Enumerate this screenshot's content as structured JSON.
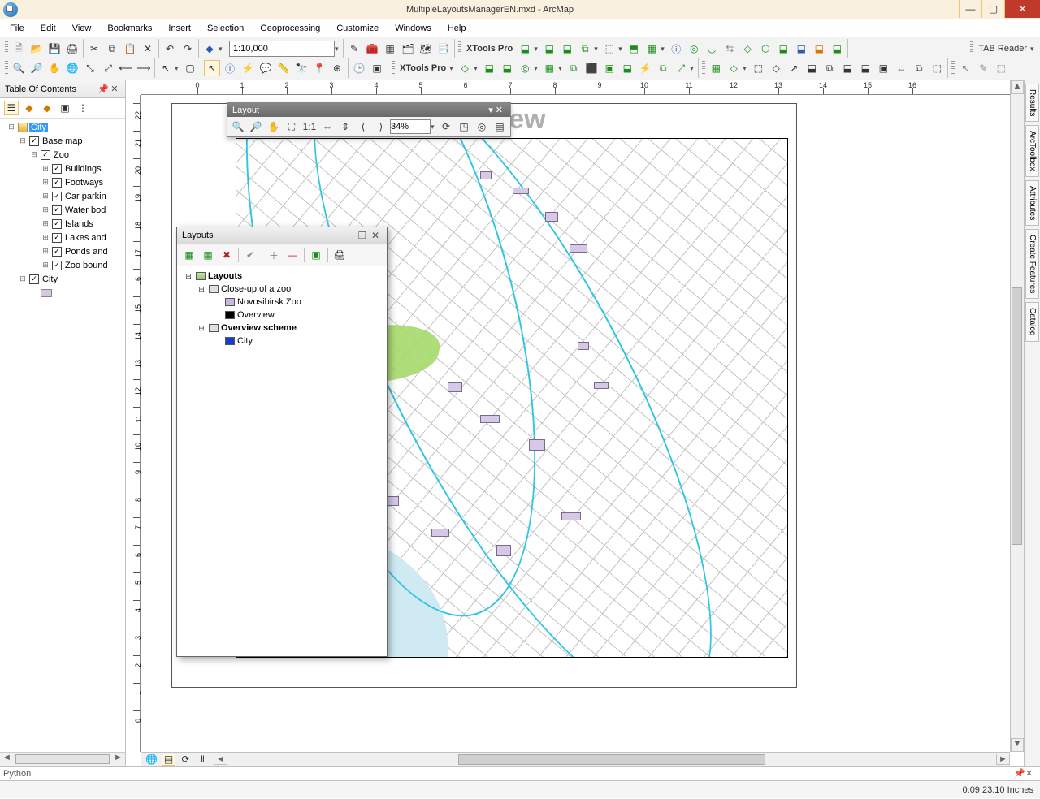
{
  "title": "MultipleLayoutsManagerEN.mxd - ArcMap",
  "menu": [
    "File",
    "Edit",
    "View",
    "Bookmarks",
    "Insert",
    "Selection",
    "Geoprocessing",
    "Customize",
    "Windows",
    "Help"
  ],
  "scale_value": "1:10,000",
  "xtools_label": "XTools Pro",
  "tab_reader_label": "TAB Reader",
  "toc": {
    "title": "Table Of Contents",
    "root": "City",
    "basemap": "Base map",
    "zoo": "Zoo",
    "layers": [
      "Buildings",
      "Footways",
      "Car parkin",
      "Water bod",
      "Islands",
      "Lakes and",
      "Ponds and",
      "Zoo bound"
    ],
    "city_layer": "City"
  },
  "layout_toolbar": {
    "title": "Layout",
    "zoom": "34%"
  },
  "layouts_panel": {
    "title": "Layouts",
    "root": "Layouts",
    "items": [
      {
        "label": "Close-up of a zoo",
        "children": [
          {
            "label": "Novosibirsk Zoo",
            "swatch": "purple"
          },
          {
            "label": "Overview",
            "swatch": "black"
          }
        ]
      },
      {
        "label": "Overview scheme",
        "bold": true,
        "children": [
          {
            "label": "City",
            "swatch": "blue"
          }
        ]
      }
    ]
  },
  "page_title": "Overview",
  "right_tabs": [
    "Results",
    "ArcToolbox",
    "Attributes",
    "Create Features",
    "Catalog"
  ],
  "python_label": "Python",
  "status": {
    "coord": "0.09 23.10",
    "units": "Inches"
  },
  "ruler_h_ticks": [
    0,
    1,
    2,
    3,
    4,
    5,
    6,
    7,
    8,
    9,
    10,
    11,
    12,
    13,
    14,
    15,
    16
  ],
  "ruler_v_ticks": [
    22,
    21,
    20,
    19,
    18,
    17,
    16,
    15,
    14,
    13,
    12,
    11,
    10,
    9,
    8,
    7,
    6,
    5,
    4,
    3,
    2,
    1,
    0
  ]
}
